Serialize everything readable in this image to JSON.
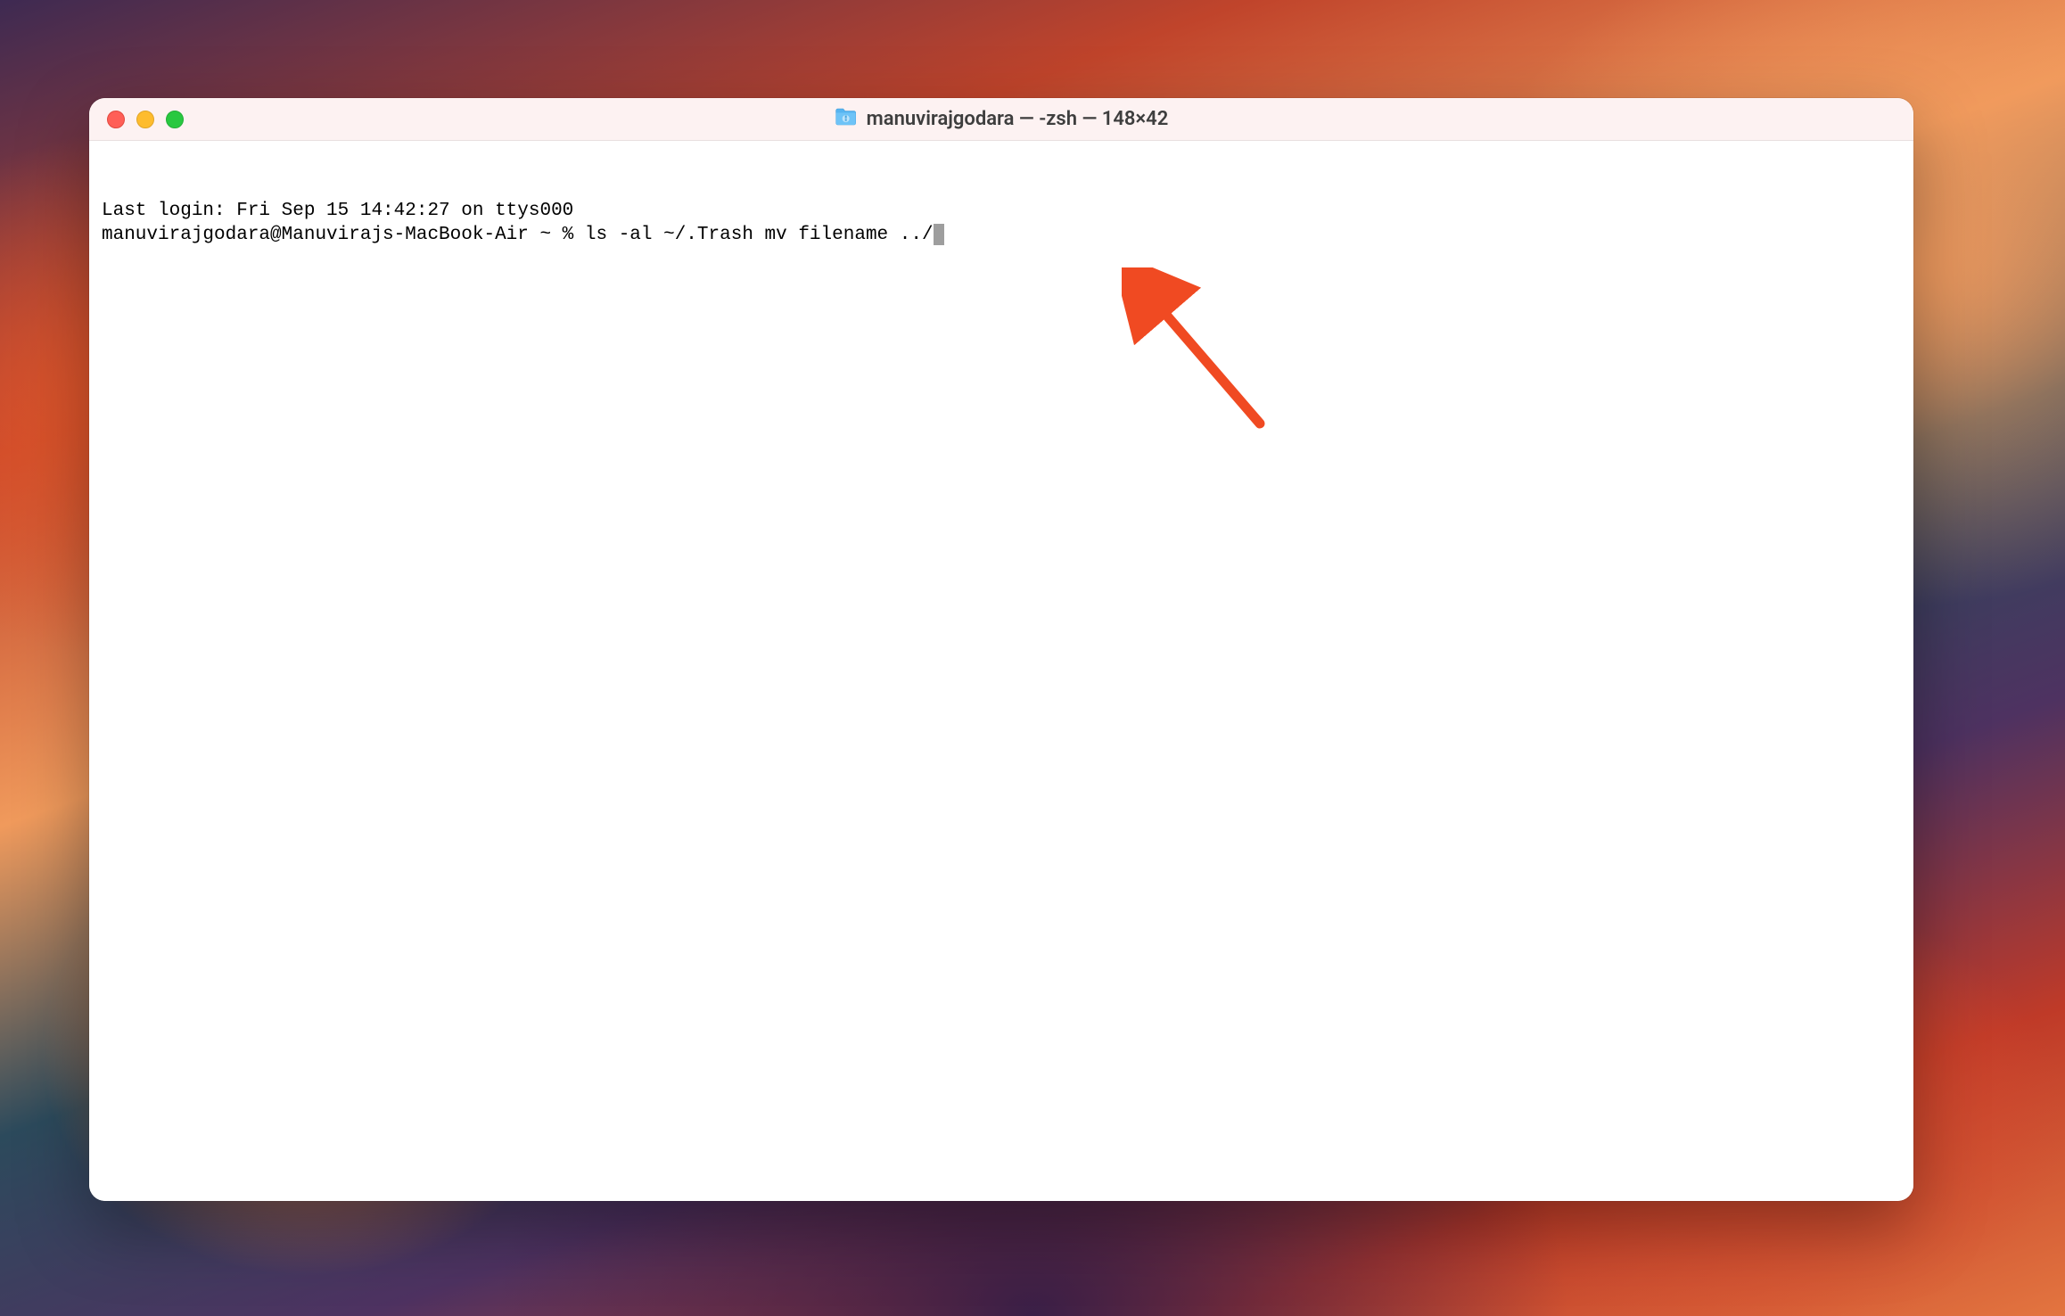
{
  "window": {
    "title": "manuvirajgodara — -zsh — 148×42"
  },
  "terminal": {
    "last_login_line": "Last login: Fri Sep 15 14:42:27 on ttys000",
    "prompt": "manuvirajgodara@Manuvirajs-MacBook-Air ~ % ",
    "command": "ls -al ~/.Trash mv filename ../"
  },
  "annotation": {
    "arrow_color": "#f04a22"
  }
}
